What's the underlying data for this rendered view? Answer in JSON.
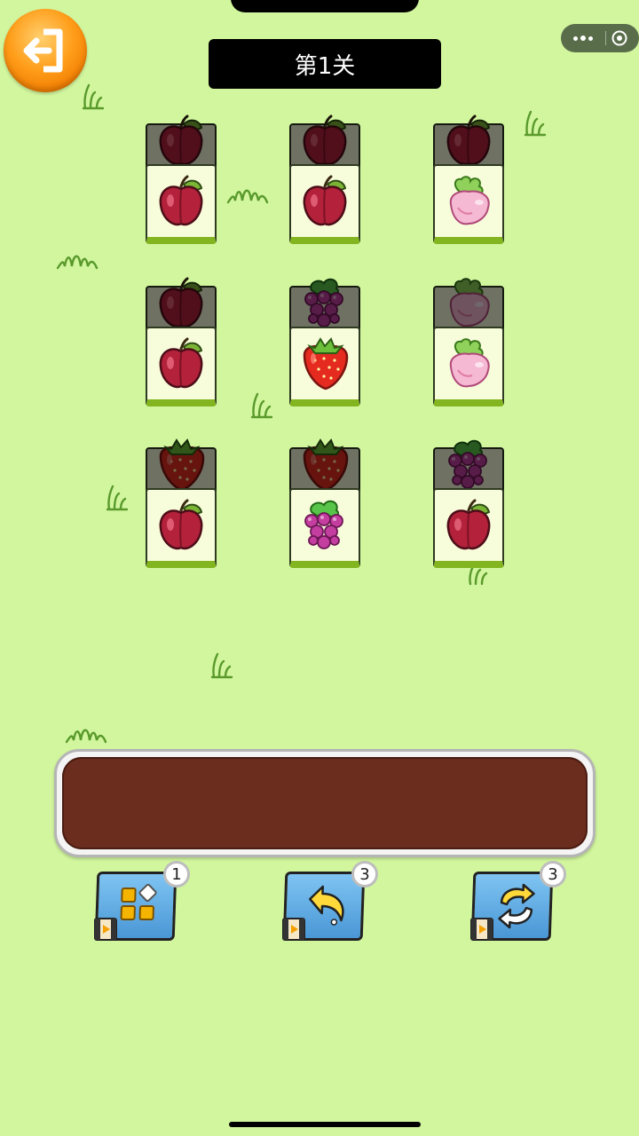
{
  "header": {
    "level_title": "第1关"
  },
  "board": {
    "tiles": [
      {
        "fruit": "plum",
        "layer": "top"
      },
      {
        "fruit": "plum",
        "layer": "top"
      },
      {
        "fruit": "radish",
        "layer": "top"
      },
      {
        "fruit": "plum",
        "layer": "top"
      },
      {
        "fruit": "strawberry",
        "layer": "top"
      },
      {
        "fruit": "radish",
        "layer": "top"
      },
      {
        "fruit": "plum",
        "layer": "top"
      },
      {
        "fruit": "grape",
        "layer": "top"
      },
      {
        "fruit": "plum",
        "layer": "top"
      }
    ],
    "under_tiles": [
      "plum",
      "plum",
      "plum",
      "plum",
      "grape",
      "radish",
      "strawberry",
      "strawberry",
      "grape"
    ]
  },
  "tray": {
    "slots_filled": 0
  },
  "tools": [
    {
      "name": "shuffle-tiles",
      "icon": "blocks-icon",
      "count": "1"
    },
    {
      "name": "undo",
      "icon": "undo-arrow-icon",
      "count": "3"
    },
    {
      "name": "swap",
      "icon": "swap-arrows-icon",
      "count": "3"
    }
  ],
  "colors": {
    "background": "#d2f69e",
    "tile_face": "#f7fcdb",
    "tile_base": "#82b51f",
    "tray": "#6b2d1e",
    "back_button": "#ff9e1a",
    "tool_blue": "#4a97d6"
  }
}
